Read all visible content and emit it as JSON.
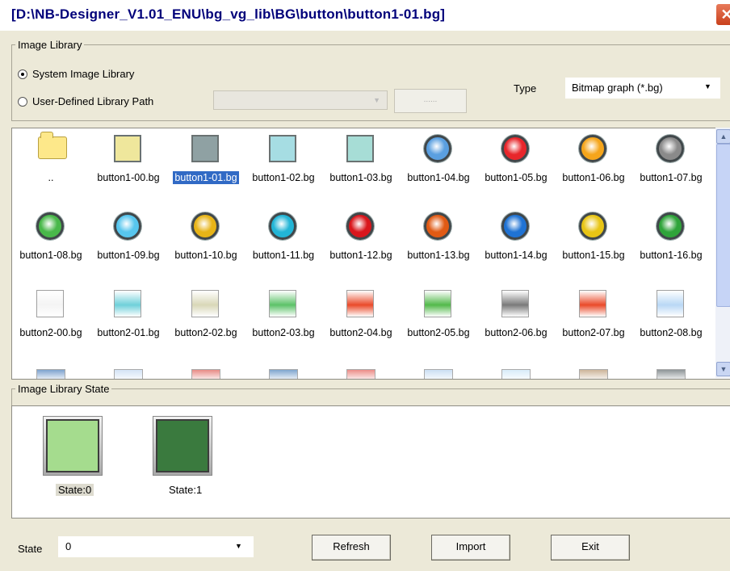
{
  "window": {
    "title": "[D:\\NB-Designer_V1.01_ENU\\bg_vg_lib\\BG\\button\\button1-01.bg]",
    "close_icon": "close-icon"
  },
  "library": {
    "group_label": "Image Library",
    "system_label": "System Image Library",
    "user_label": "User-Defined Library Path",
    "user_path_value": "",
    "browse_label": "......",
    "type_label": "Type",
    "type_value": "Bitmap graph (*.bg)"
  },
  "gallery": {
    "folder_label": "..",
    "items": [
      {
        "label": "button1-00.bg",
        "color": "#efe79c"
      },
      {
        "label": "button1-01.bg",
        "color": "#8fa1a3",
        "selected": true
      },
      {
        "label": "button1-02.bg",
        "color": "#a6dde3"
      },
      {
        "label": "button1-03.bg",
        "color": "#a7ddd6"
      },
      {
        "label": "button1-04.bg",
        "color": "#5a9fe0"
      },
      {
        "label": "button1-05.bg",
        "color": "#e8262b"
      },
      {
        "label": "button1-06.bg",
        "color": "#f5a51b"
      },
      {
        "label": "button1-07.bg",
        "color": "#8a8a8a"
      },
      {
        "label": "button1-08.bg",
        "color": "#49b84a"
      },
      {
        "label": "button1-09.bg",
        "color": "#57c6ee"
      },
      {
        "label": "button1-10.bg",
        "color": "#e7b417"
      },
      {
        "label": "button1-11.bg",
        "color": "#22b5d6"
      },
      {
        "label": "button1-12.bg",
        "color": "#d9161c"
      },
      {
        "label": "button1-13.bg",
        "color": "#e05a14"
      },
      {
        "label": "button1-14.bg",
        "color": "#1f73d4"
      },
      {
        "label": "button1-15.bg",
        "color": "#e8c515"
      },
      {
        "label": "button1-16.bg",
        "color": "#2fa43a"
      },
      {
        "label": "button2-00.bg",
        "color": "#f4f4f4"
      },
      {
        "label": "button2-01.bg",
        "color": "#6fd0da"
      },
      {
        "label": "button2-02.bg",
        "color": "#d9d7b7"
      },
      {
        "label": "button2-03.bg",
        "color": "#5dc269"
      },
      {
        "label": "button2-04.bg",
        "color": "#ea4a2a"
      },
      {
        "label": "button2-05.bg",
        "color": "#52b94a"
      },
      {
        "label": "button2-06.bg",
        "color": "#7a7a7a"
      },
      {
        "label": "button2-07.bg",
        "color": "#ea4a2a"
      },
      {
        "label": "button2-08.bg",
        "color": "#b9d8f5"
      }
    ],
    "partial_colors": [
      "#7ea3cf",
      "#d3e3f5",
      "#e88b86",
      "#7fa6cf",
      "#ec8d88",
      "#cbdff3",
      "#d8ebf8",
      "#cdb59a",
      "#8e9598"
    ]
  },
  "state_panel": {
    "group_label": "Image Library State",
    "states": [
      {
        "label": "State:0",
        "color": "#a5dc8e",
        "selected": true
      },
      {
        "label": "State:1",
        "color": "#3a7a3e"
      }
    ]
  },
  "footer": {
    "state_label": "State",
    "state_value": "0",
    "refresh_label": "Refresh",
    "import_label": "Import",
    "exit_label": "Exit"
  }
}
